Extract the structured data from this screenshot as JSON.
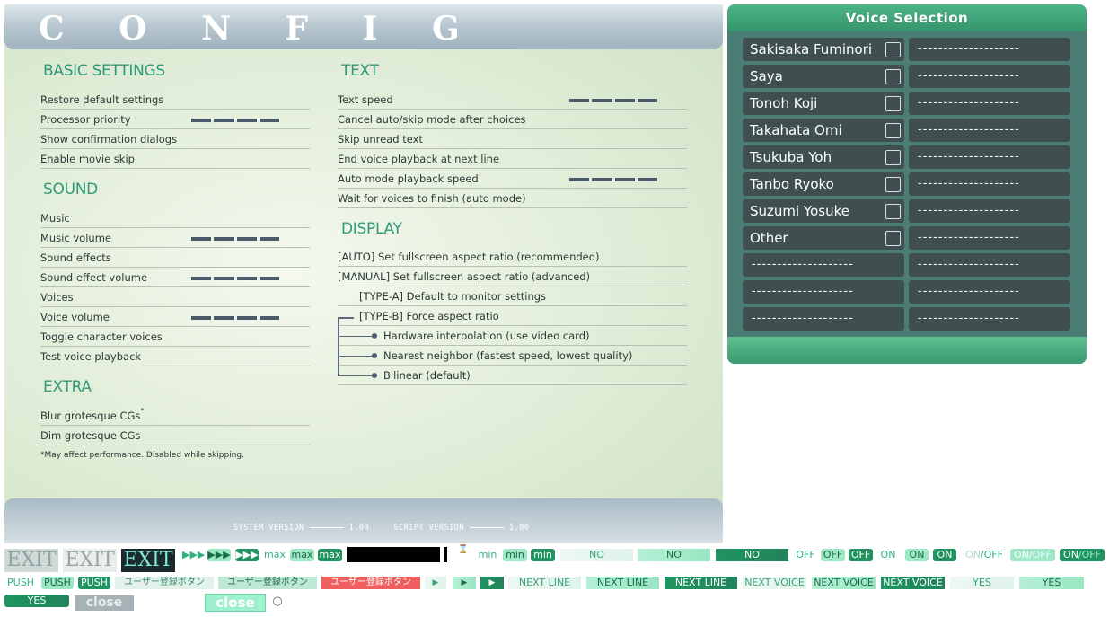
{
  "config": {
    "title": "C O N F I G",
    "basic_title": "BASIC SETTINGS",
    "basic": [
      "Restore default settings",
      "Processor priority",
      "Show confirmation dialogs",
      "Enable movie skip"
    ],
    "sound_title": "SOUND",
    "sound": [
      "Music",
      "Music volume",
      "Sound effects",
      "Sound effect volume",
      "Voices",
      "Voice volume",
      "Toggle character voices",
      "Test voice playback"
    ],
    "extra_title": "EXTRA",
    "extra": [
      "Blur grotesque CGs",
      "Dim grotesque CGs"
    ],
    "extra_mark": "*",
    "extra_note": "*May affect performance. Disabled while skipping.",
    "text_title": "TEXT",
    "text": [
      "Text speed",
      "Cancel auto/skip mode after choices",
      "Skip unread text",
      "End voice playback at next line",
      "Auto mode playback speed",
      "Wait for voices to finish (auto mode)"
    ],
    "display_title": "DISPLAY",
    "display": [
      "[AUTO] Set fullscreen aspect ratio (recommended)",
      "[MANUAL] Set fullscreen aspect ratio (advanced)",
      "[TYPE-A] Default to monitor settings",
      "[TYPE-B] Force aspect ratio",
      "Hardware interpolation (use video card)",
      "Nearest neighbor (fastest speed, lowest quality)",
      "Bilinear (default)"
    ],
    "system_version_label": "SYSTEM VERSION",
    "system_version": "1.00",
    "script_version_label": "SCRIPT VERSION",
    "script_version": "1.00"
  },
  "voice": {
    "title": "Voice Selection",
    "names": [
      "Sakisaka Fuminori",
      "Saya",
      "Tonoh Koji",
      "Takahata Omi",
      "Tsukuba Yoh",
      "Tanbo Ryoko",
      "Suzumi Yosuke",
      "Other"
    ],
    "placeholder": "--------------------"
  },
  "sprites": {
    "exit": "EXIT",
    "arrows": "▶▶▶",
    "max": "max",
    "min": "min",
    "no": "NO",
    "off": "OFF",
    "on": "ON",
    "on_off_on": "ON",
    "on_off_sep": "/",
    "on_off_off": "OFF",
    "push": "PUSH",
    "user_btn": "ユーザー登録ボタン",
    "play": "▶",
    "next_line": "NEXT LINE",
    "next_voice": "NEXT VOICE",
    "yes": "YES",
    "close": "close",
    "radio": "○"
  },
  "colors": {
    "accent": "#2f9a7a",
    "panel": "#4c7d74",
    "cell": "#3f4f4f",
    "green_dark": "#1f9461",
    "red": "#f05f5f"
  }
}
